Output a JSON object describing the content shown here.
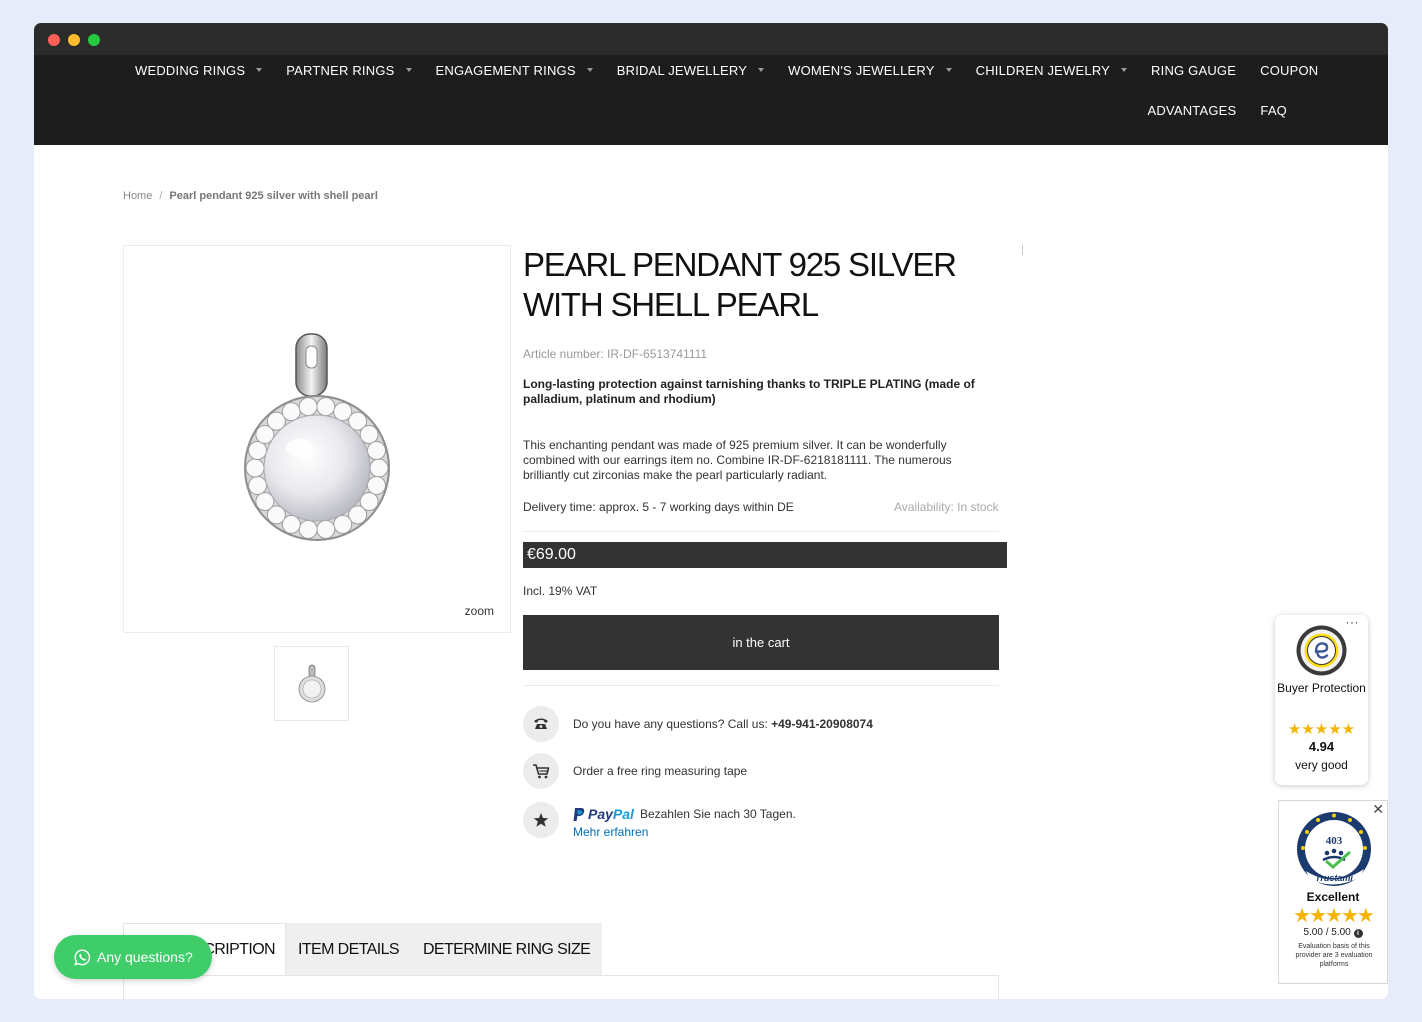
{
  "nav": {
    "row1": [
      {
        "label": "WEDDING RINGS",
        "dropdown": true
      },
      {
        "label": "PARTNER RINGS",
        "dropdown": true
      },
      {
        "label": "ENGAGEMENT RINGS",
        "dropdown": true
      },
      {
        "label": "BRIDAL JEWELLERY",
        "dropdown": true
      },
      {
        "label": "WOMEN'S JEWELLERY",
        "dropdown": true
      },
      {
        "label": "CHILDREN JEWELRY",
        "dropdown": true
      },
      {
        "label": "RING GAUGE",
        "dropdown": false
      },
      {
        "label": "COUPON",
        "dropdown": false
      }
    ],
    "row2": [
      {
        "label": "ADVANTAGES"
      },
      {
        "label": "FAQ"
      }
    ]
  },
  "breadcrumb": {
    "home": "Home",
    "separator": "/",
    "current": "Pearl pendant 925 silver with shell pearl"
  },
  "gallery": {
    "zoom_label": "zoom"
  },
  "product": {
    "title": "PEARL PENDANT 925 SILVER WITH SHELL PEARL",
    "article_number": "Article number: IR-DF-6513741111",
    "highlight": "Long-lasting protection against tarnishing thanks to TRIPLE PLATING (made of palladium, platinum and rhodium)",
    "description": "This enchanting pendant was made of 925 premium silver. It can be wonderfully combined with our earrings item no. Combine IR-DF-6218181111. The numerous brilliantly cut zirconias make the pearl particularly radiant.",
    "delivery": "Delivery time: approx. 5 - 7 working days within DE",
    "availability": "Availability: In stock",
    "price": "€69.00",
    "vat": "Incl. 19% VAT",
    "cart_button": "in the cart"
  },
  "info": {
    "questions_text": "Do you have any questions? Call us: ",
    "phone": "+49-941-20908074",
    "tape_text": "Order a free ring measuring tape",
    "paypal_pay": "Pay",
    "paypal_pal": "Pal",
    "paypal_text": "Bezahlen Sie nach 30 Tagen.",
    "paypal_link": "Mehr erfahren"
  },
  "tabs": [
    {
      "label": "DESCRIPTION",
      "visible_label": "CRIPTION",
      "active": true
    },
    {
      "label": "ITEM DETAILS",
      "active": false
    },
    {
      "label": "DETERMINE RING SIZE",
      "active": false
    }
  ],
  "chat": {
    "label": "Any questions?",
    "color": "#3fcd6a"
  },
  "trusted_shops": {
    "menu": "···",
    "title": "Buyer Protection",
    "stars": "★★★★★",
    "score": "4.94",
    "rating_label": "very good"
  },
  "trustami": {
    "close": "✕",
    "seal_number": "403",
    "seal_brand": "Trustami",
    "label": "Excellent",
    "stars": "★★★★★",
    "score": "5.00 / 5.00",
    "note": "Evaluation basis of this provider are 3 evaluation platforms"
  },
  "colors": {
    "nav_background": "#1d1d1d",
    "price_background": "#333333",
    "button_background": "#333333",
    "paypal_blue": "#253b80",
    "paypal_light_blue": "#179bd7",
    "star_color": "#f5b400"
  }
}
